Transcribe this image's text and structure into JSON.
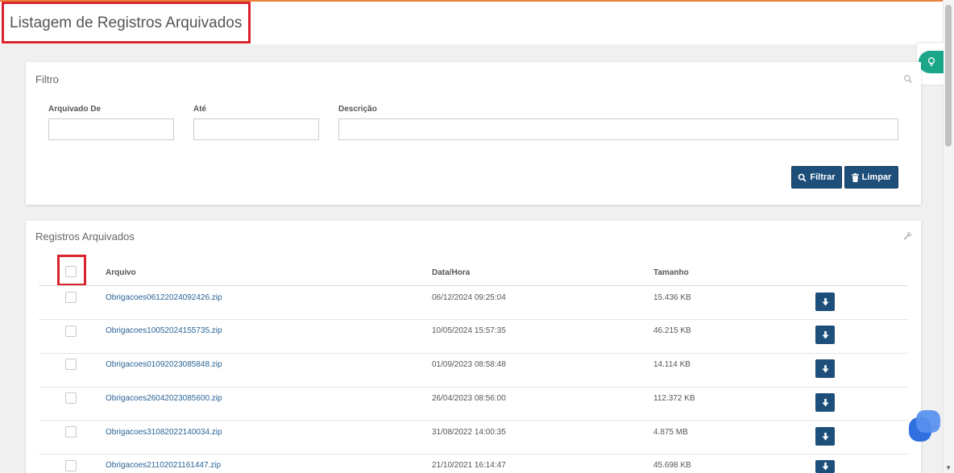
{
  "page": {
    "title": "Listagem de Registros Arquivados"
  },
  "filter": {
    "title": "Filtro",
    "archived_from_label": "Arquivado De",
    "until_label": "Até",
    "description_label": "Descrição",
    "archived_from_value": "",
    "until_value": "",
    "description_value": "",
    "filter_button_label": "Filtrar",
    "clear_button_label": "Limpar"
  },
  "records": {
    "title": "Registros Arquivados",
    "columns": {
      "file": "Arquivo",
      "datetime": "Data/Hora",
      "size": "Tamanho"
    },
    "rows": [
      {
        "file": "Obrigacoes06122024092426.zip",
        "datetime": "06/12/2024 09:25:04",
        "size": "15.436 KB"
      },
      {
        "file": "Obrigacoes10052024155735.zip",
        "datetime": "10/05/2024 15:57:35",
        "size": "46.215 KB"
      },
      {
        "file": "Obrigacoes01092023085848.zip",
        "datetime": "01/09/2023 08:58:48",
        "size": "14.114 KB"
      },
      {
        "file": "Obrigacoes26042023085600.zip",
        "datetime": "26/04/2023 08:56:00",
        "size": "112.372 KB"
      },
      {
        "file": "Obrigacoes31082022140034.zip",
        "datetime": "31/08/2022 14:00:35",
        "size": "4.875 MB"
      },
      {
        "file": "Obrigacoes21102021161447.zip",
        "datetime": "21/10/2021 16:14:47",
        "size": "45.698 KB"
      }
    ]
  },
  "icons": {
    "search": "search-icon",
    "wrench": "wrench-icon",
    "lightbulb": "lightbulb-icon",
    "download": "download-icon",
    "trash": "trash-icon",
    "chat": "chat-icon"
  },
  "colors": {
    "accent_orange": "#e8823a",
    "primary_button": "#1e4f7a",
    "hint_green": "#1ba68a",
    "link": "#2a6496",
    "highlight_red": "#d9232e"
  }
}
